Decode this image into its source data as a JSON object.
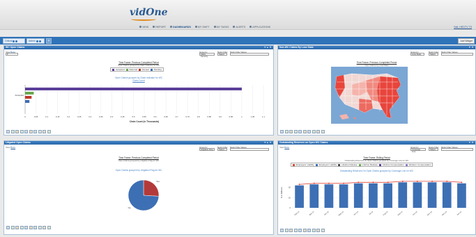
{
  "header": {
    "logo_text": "vidOne",
    "nav": [
      {
        "label": "VIEW",
        "icon": "search-icon"
      },
      {
        "label": "REPORT",
        "icon": "report-icon"
      },
      {
        "label": "DASHBOARDS",
        "icon": "dashboard-icon",
        "active": true
      },
      {
        "label": "MY SHIFT",
        "icon": "calendar-icon"
      },
      {
        "label": "MY TASKS",
        "icon": "tasks-icon"
      },
      {
        "label": "ALERTS",
        "icon": "bell-icon"
      },
      {
        "label": "APPLICATIONS",
        "icon": "apps-icon"
      }
    ],
    "user_link": "Sait, HEDTV TS"
  },
  "tabs": [
    {
      "label": "Critical"
    },
    {
      "label": "Admin"
    }
  ],
  "add_widget_label": "Add Widget",
  "panels": {
    "wc": {
      "title": "WC Open Claims",
      "view_label": "View",
      "view_link": "Base",
      "group_by_label": "Group by",
      "group_by_value": "Claim Severity",
      "metric_filter_label": "Metric Filter",
      "metric_filter_value": "Select",
      "metric_filter_values_label": "Metric Filter Values",
      "time_frame": "Time Frame: Previous Completed Period",
      "time_frame_sub": "Open Claims grouped by Claim indicator for WC",
      "chart_title": "Open Claims grouped by Claim indicator for WC",
      "chart_subtitle": "Claim Count"
    },
    "nonwc": {
      "title": "Non-WC Claims By Loss State",
      "group_by_label": "Group by",
      "group_by_value": "Loss State",
      "metric_filter_label": "Metric Filter",
      "metric_filter_value": "Select",
      "metric_filter_values_label": "Metric Filter Values",
      "time_frame": "Time Frame: Previous Completed Period",
      "time_frame_sub": "Open Claims by Loss State"
    },
    "litigated": {
      "title": "Litigated Open Claims",
      "view_label": "View",
      "view_link": "Base",
      "group_by_label": "Group by",
      "group_by_value": "Litigation Flag",
      "metric_filter_label": "Metric Filter",
      "metric_filter_value": "Select",
      "metric_filter_values_label": "Metric Filter Values",
      "time_frame": "Time Frame: Previous Completed Period",
      "time_frame_sub": "Open Claims grouped by Litigation Flag for WC",
      "chart_title": "Open Claims grouped by Litigation Flag for WC"
    },
    "reserves": {
      "title": "Outstanding Reserves on Open WC Claims",
      "view_label": "View",
      "view_link": "Base",
      "group_by_label": "Group by",
      "group_by_value": "Coverage Line",
      "metric_filter_label": "Metric Filter",
      "metric_filter_value": "Select",
      "metric_filter_values_label": "Metric Filter Values",
      "time_frame": "Time Frame: Rolling Period",
      "time_frame_sub": "Outstanding Reserves on Open Claims grouped by Coverage Line for WC",
      "chart_title": "Outstanding Reserves On Open Claims grouped by Coverage Line for WC"
    }
  },
  "chart_data": [
    {
      "type": "bar",
      "orientation": "horizontal",
      "title": "Open Claims grouped by Claim indicator for WC",
      "subtitle": "Claim Count",
      "xlabel": "Claim Count (in Thousands)",
      "xlim": [
        0,
        1.1
      ],
      "x_ticks": [
        "0",
        "0.05",
        "0.1",
        "0.15",
        "0.2",
        "0.25",
        "0.3",
        "0.35",
        "0.4",
        "0.45",
        "0.5",
        "0.55",
        "0.6",
        "0.65",
        "0.7",
        "0.75",
        "0.8",
        "0.85",
        "0.9",
        "0.95",
        "1",
        "1.05",
        "1.1"
      ],
      "categories": [
        "Accepted",
        "Deferred",
        "Denied",
        "Pending"
      ],
      "series": [
        {
          "name": "Accepted",
          "color": "#5b3f99",
          "values": [
            1.0
          ]
        },
        {
          "name": "Deferred",
          "color": "#6aa84f",
          "values": [
            0.04
          ]
        },
        {
          "name": "Denied",
          "color": "#c0392b",
          "values": [
            0.03
          ]
        },
        {
          "name": "Pending",
          "color": "#3d6fb4",
          "values": [
            0.02
          ]
        }
      ]
    },
    {
      "type": "pie",
      "title": "Open Claims grouped by Litigation Flag for WC",
      "slices": [
        {
          "label": "Yes",
          "value": 26,
          "color": "#b33a3a"
        },
        {
          "label": "No",
          "value": 74,
          "color": "#3d6fb4"
        }
      ]
    },
    {
      "type": "bar",
      "title": "Outstanding Reserves On Open Claims grouped by Coverage Line for WC",
      "ylabel": "$ in Millions",
      "ylim": [
        0,
        30
      ],
      "y_ticks": [
        "0",
        "10",
        "20"
      ],
      "categories": [
        "Feb-13",
        "Mar-13",
        "Apr-13",
        "May-13",
        "Jun-13",
        "Jul-13",
        "Aug-13",
        "Sep-13",
        "Oct-13",
        "Nov-13",
        "Dec-13",
        "Jan-14"
      ],
      "legend": [
        "Employers' Liability",
        "Employers' Liability",
        "Lifetime Release",
        "Lifetime Release",
        "Lifetime Compensation",
        "Workers' Compensation"
      ],
      "series": [
        {
          "name": "Workers' Compensation",
          "color": "#3d6fb4",
          "values": [
            22,
            23,
            23,
            23,
            24,
            24,
            24,
            25,
            25,
            25,
            25,
            24
          ]
        },
        {
          "name": "Employers' Liability",
          "color": "#e0443a",
          "line": true,
          "values": [
            23,
            24,
            24,
            24,
            25,
            25,
            25,
            26,
            26,
            26,
            26,
            25
          ]
        }
      ]
    }
  ]
}
